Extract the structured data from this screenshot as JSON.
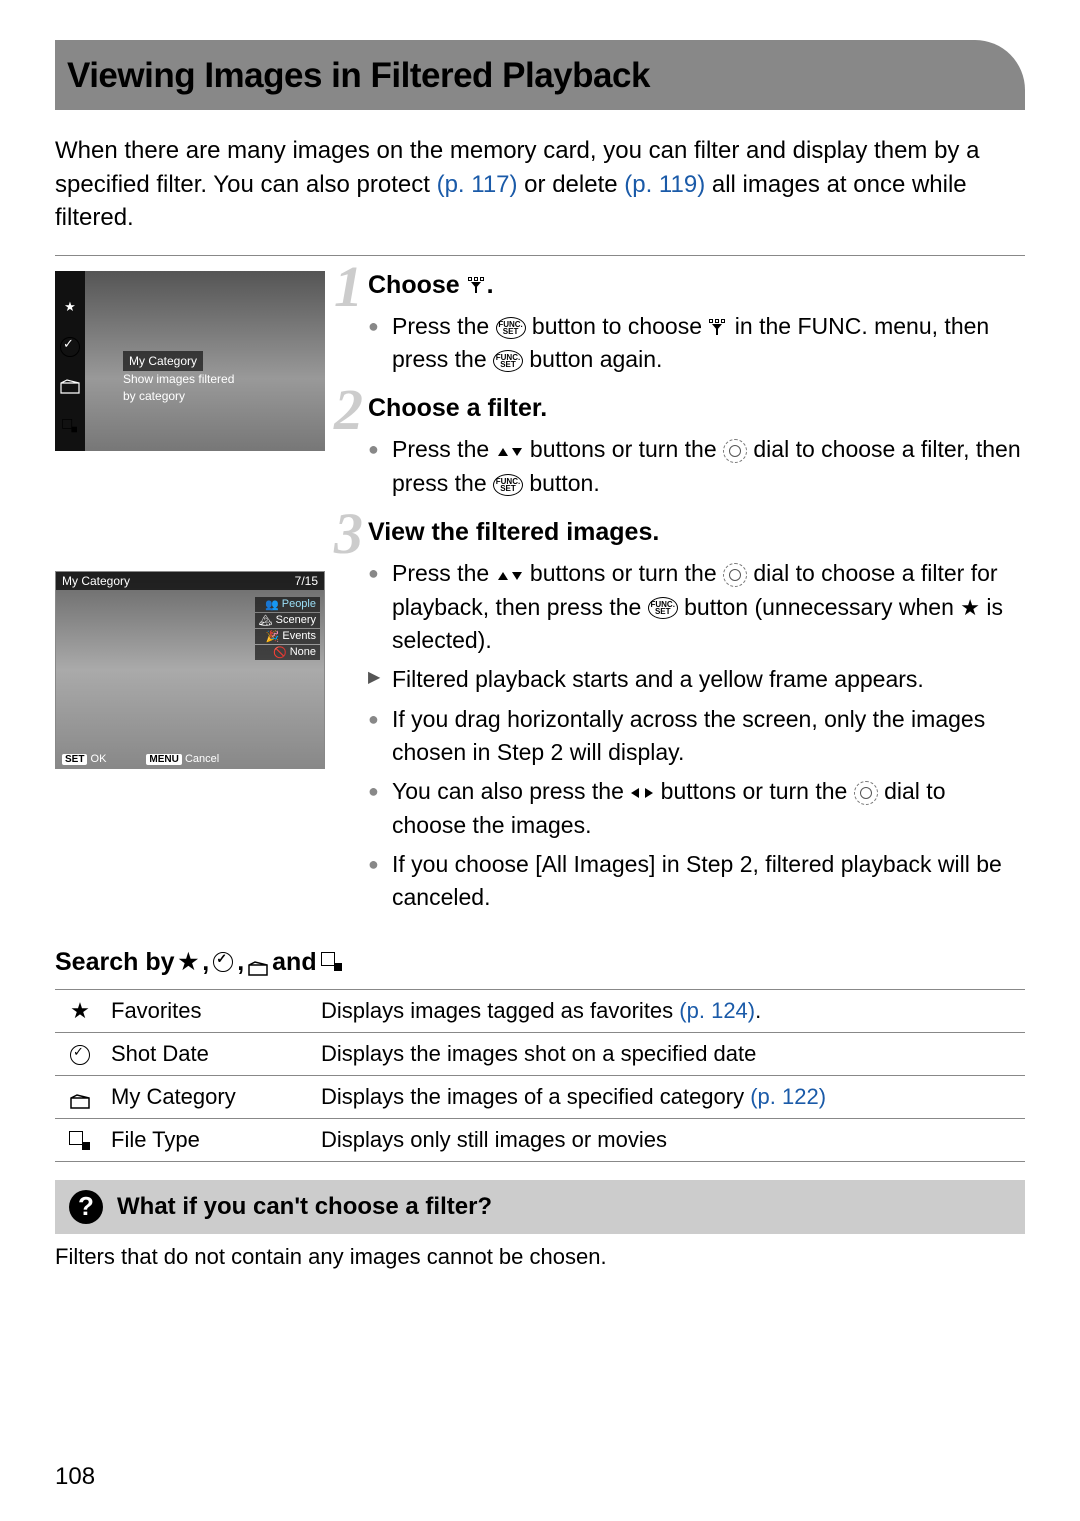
{
  "title": "Viewing Images in Filtered Playback",
  "intro": {
    "t1": "When there are many images on the memory card, you can filter and display them by a specified filter. You can also protect ",
    "link1": "(p. 117)",
    "t2": "  or delete ",
    "link2": "(p. 119)",
    "t3": " all images at once while filtered."
  },
  "thumb1": {
    "label": "My Category",
    "tip1": "Show images filtered",
    "tip2": "by category"
  },
  "thumb2": {
    "header_left": "My Category",
    "header_right": "7/15",
    "tag1": "People",
    "tag2": "Scenery",
    "tag3": "Events",
    "tag4": "None",
    "set": "SET",
    "ok": "OK",
    "menu": "MENU",
    "cancel": "Cancel"
  },
  "steps": {
    "s1": {
      "num": "1",
      "title": "Choose ",
      "title_end": ".",
      "b1a": "Press the ",
      "b1b": " button to choose ",
      "b1c": " in the FUNC. menu, then press the ",
      "b1d": " button again."
    },
    "s2": {
      "num": "2",
      "title": "Choose a filter.",
      "b1a": "Press the ",
      "b1b": " buttons or turn the ",
      "b1c": " dial to choose a filter, then press the ",
      "b1d": " button."
    },
    "s3": {
      "num": "3",
      "title": "View the filtered images.",
      "b1a": "Press the ",
      "b1b": " buttons or turn the ",
      "b1c": " dial to choose a filter for playback, then press the ",
      "b1d": " button (unnecessary when ",
      "b1e": " is selected).",
      "b2": "Filtered playback starts and a yellow frame appears.",
      "b3": "If you drag horizontally across the screen, only the images chosen in Step 2 will display.",
      "b4a": "You can also press the ",
      "b4b": " buttons or turn the ",
      "b4c": " dial to choose the images.",
      "b5": "If you choose [All Images] in Step 2, filtered playback will be canceled."
    }
  },
  "search_heading": {
    "a": "Search by ",
    "b": ", ",
    "c": ", ",
    "d": " and "
  },
  "table": {
    "r1": {
      "nm": "Favorites",
      "desc": "Displays images tagged as favorites ",
      "link": "(p. 124)",
      "tail": "."
    },
    "r2": {
      "nm": "Shot Date",
      "desc": "Displays the images shot on a specified date"
    },
    "r3": {
      "nm": "My Category",
      "desc": "Displays the images of a specified category ",
      "link": "(p. 122)"
    },
    "r4": {
      "nm": "File Type",
      "desc": "Displays only still images or movies"
    }
  },
  "func_label_top": "FUNC.",
  "func_label_bot": "SET",
  "note": {
    "title": "What if you can't choose a filter?",
    "body": "Filters that do not contain any images cannot be chosen."
  },
  "page_num": "108"
}
